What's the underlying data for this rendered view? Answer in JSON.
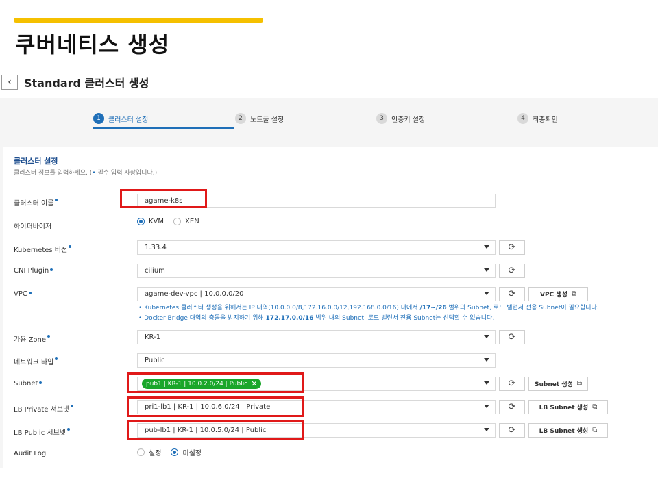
{
  "slide": {
    "title": "쿠버네티스 생성"
  },
  "header": {
    "back_icon": "‹",
    "title": "Standard 클러스터 생성"
  },
  "steps": [
    {
      "num": "1",
      "label": "클러스터 설정"
    },
    {
      "num": "2",
      "label": "노드풀 설정"
    },
    {
      "num": "3",
      "label": "인증키 설정"
    },
    {
      "num": "4",
      "label": "최종확인"
    }
  ],
  "section": {
    "title": "클러스터 설정",
    "subtitle_pre": "클러스터 정보를 입력하세요. (",
    "subtitle_dot": "•",
    "subtitle_post": " 필수 입력 사항입니다.)"
  },
  "form": {
    "cluster_name": {
      "label": "클러스터 이름",
      "value": "agame-k8s"
    },
    "hypervisor": {
      "label": "하이퍼바이저",
      "options": [
        "KVM",
        "XEN"
      ],
      "selected": "KVM"
    },
    "k8s_version": {
      "label": "Kubernetes 버전",
      "value": "1.33.4"
    },
    "cni": {
      "label": "CNI Plugin",
      "value": "cilium"
    },
    "vpc": {
      "label": "VPC",
      "value": "agame-dev-vpc | 10.0.0.0/20",
      "create_label": "VPC 생성"
    },
    "notes": [
      {
        "pre": "• Kubernetes 클러스터 생성을 위해서는 IP 대역(10.0.0.0/8,172.16.0.0/12,192.168.0.0/16) 내에서 ",
        "bold": "/17~/26",
        "post": " 범위의 Subnet, 로드 밸런서 전용 Subnet이 필요합니다."
      },
      {
        "pre": "• Docker Bridge 대역의 충돌을 방지하기 위해 ",
        "bold": "172.17.0.0/16",
        "post": " 범위 내의 Subnet, 로드 밸런서 전용 Subnet는 선택할 수 없습니다."
      }
    ],
    "zone": {
      "label": "가용 Zone",
      "value": "KR-1"
    },
    "network_type": {
      "label": "네트워크 타입",
      "value": "Public"
    },
    "subnet": {
      "label": "Subnet",
      "tag": "pub1 | KR-1 | 10.0.2.0/24 | Public",
      "tag_close": "✕",
      "create_label": "Subnet 생성"
    },
    "lb_private": {
      "label": "LB Private 서브넷",
      "value": "pri1-lb1 | KR-1 | 10.0.6.0/24 | Private",
      "create_label": "LB Subnet 생성"
    },
    "lb_public": {
      "label": "LB Public 서브넷",
      "value": "pub-lb1 | KR-1 | 10.0.5.0/24 | Public",
      "create_label": "LB Subnet 생성"
    },
    "audit_log": {
      "label": "Audit Log",
      "options": [
        "설정",
        "미설정"
      ],
      "selected": "미설정"
    }
  },
  "icons": {
    "refresh": "⟳",
    "external": "⧉"
  },
  "colors": {
    "accent": "#1f6fb8",
    "highlight": "#e01919",
    "tag_bg": "#1aa62a",
    "slide_bar": "#f5c000"
  }
}
